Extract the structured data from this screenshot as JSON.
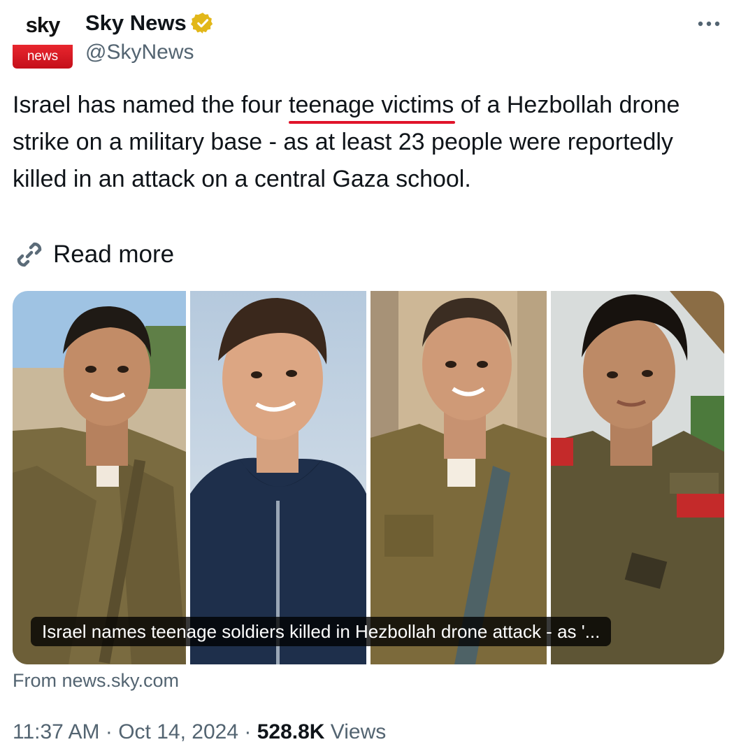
{
  "author": {
    "logo_top": "sky",
    "logo_bottom": "news",
    "display_name": "Sky News",
    "handle": "@SkyNews",
    "verified_color": "#e2b719"
  },
  "tweet": {
    "text_before": "Israel has named the four ",
    "text_highlight": "teenage victims",
    "text_after": " of a Hezbollah drone strike on a military base - as at least 23 people were reportedly killed in an attack on a central Gaza school.",
    "highlight_color": "#e0142a"
  },
  "read_more": {
    "label": "Read more",
    "icon": "link-icon"
  },
  "card": {
    "caption": "Israel names teenage soldiers killed in Hezbollah drone attack - as '...",
    "source": "From news.sky.com"
  },
  "meta": {
    "time": "11:37 AM",
    "separator": "·",
    "date": "Oct 14, 2024",
    "views_count": "528.8K",
    "views_label": "Views"
  },
  "icons": {
    "more": "more-icon",
    "verified": "verified-badge-icon"
  }
}
